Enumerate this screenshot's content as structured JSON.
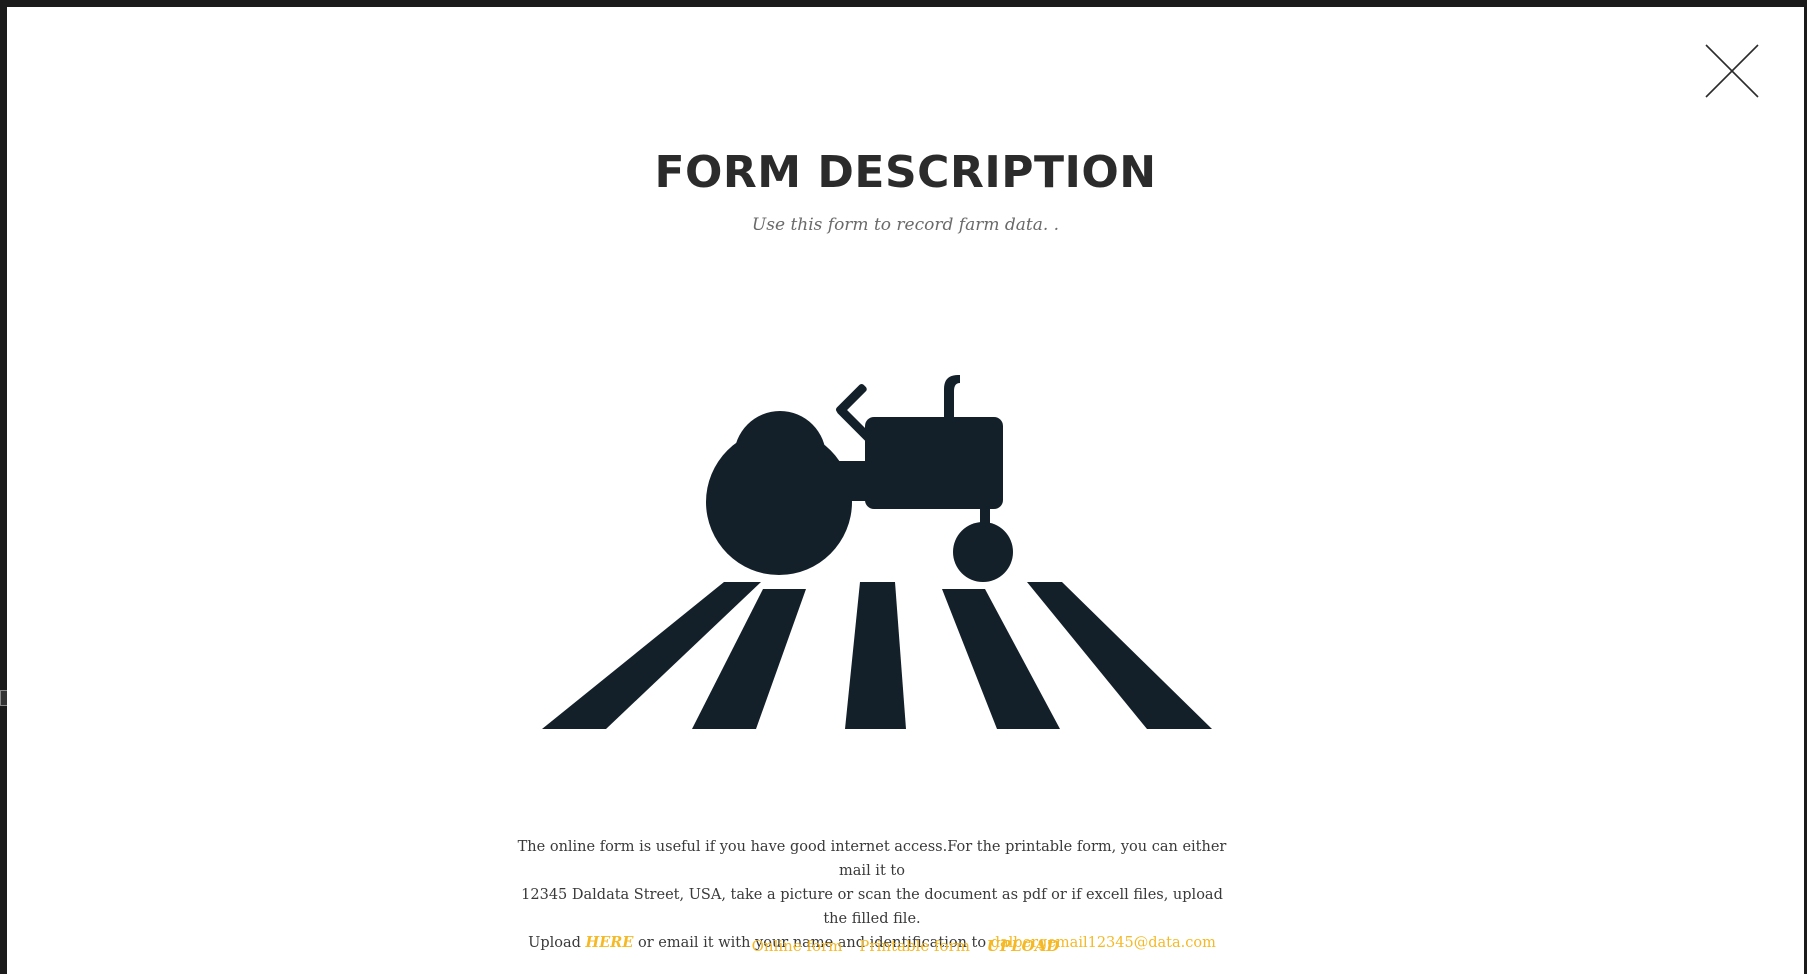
{
  "modal": {
    "title": "FORM DESCRIPTION",
    "subtitle": "Use this form to record farm data. .",
    "close_icon": "close-icon",
    "illustration_icon": "tractor-field-icon",
    "description": {
      "line1": "The online form is useful if you have good internet access.For the printable form, you can either mail it to",
      "line2": "12345 Daldata Street, USA, take a picture or scan the document as pdf or if excell files, upload the filled file.",
      "upload_prefix": "Upload",
      "here_link": "HERE",
      "email_prefix": "or email it with your name and identification to",
      "email_link": "dalbergemail12345@data.com"
    },
    "links": {
      "online_form": "Online form",
      "printable_form": "Printable form",
      "upload": "UPLOAD"
    }
  },
  "colors": {
    "accent": "#f5b926",
    "title": "#2b2b2b",
    "illustration": "#13202a",
    "backdrop": "#1b1b1b"
  }
}
